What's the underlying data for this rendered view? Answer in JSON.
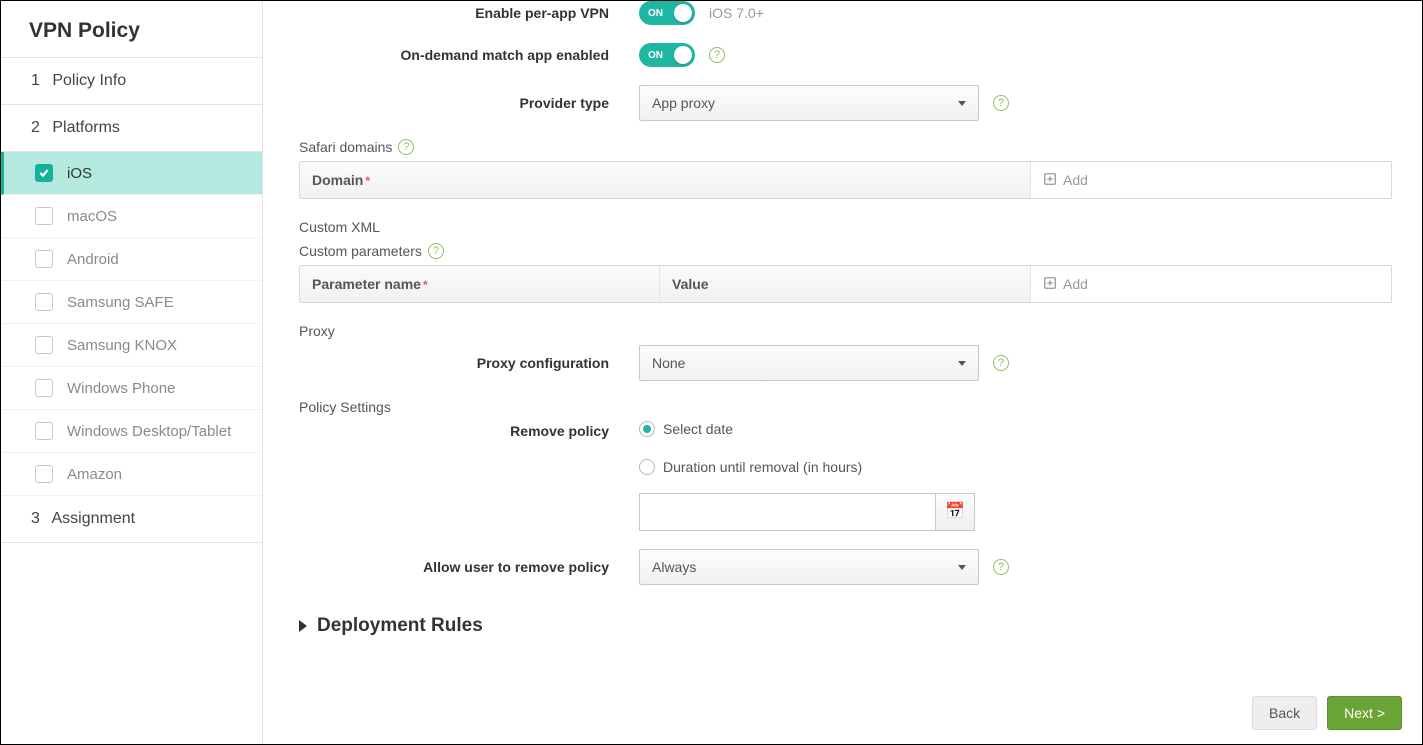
{
  "header": {
    "title": "VPN Policy"
  },
  "steps": {
    "s1": {
      "num": "1",
      "label": "Policy Info"
    },
    "s2": {
      "num": "2",
      "label": "Platforms"
    },
    "s3": {
      "num": "3",
      "label": "Assignment"
    }
  },
  "platforms": {
    "ios": "iOS",
    "macos": "macOS",
    "android": "Android",
    "safe": "Samsung SAFE",
    "knox": "Samsung KNOX",
    "winphone": "Windows Phone",
    "windesktop": "Windows Desktop/Tablet",
    "amazon": "Amazon"
  },
  "form": {
    "enable_per_app_vpn": {
      "label": "Enable per-app VPN",
      "toggle": "ON",
      "hint": "iOS 7.0+"
    },
    "on_demand_match": {
      "label": "On-demand match app enabled",
      "toggle": "ON"
    },
    "provider_type": {
      "label": "Provider type",
      "value": "App proxy"
    },
    "safari_domains": {
      "label": "Safari domains",
      "col1": "Domain",
      "add": "Add"
    },
    "custom_xml": {
      "label": "Custom XML",
      "params_label": "Custom parameters",
      "col1": "Parameter name",
      "col2": "Value",
      "add": "Add"
    },
    "proxy": {
      "section": "Proxy",
      "config_label": "Proxy configuration",
      "config_value": "None"
    },
    "policy_settings": {
      "section": "Policy Settings"
    },
    "remove_policy": {
      "label": "Remove policy",
      "opt1": "Select date",
      "opt2": "Duration until removal (in hours)"
    },
    "allow_remove": {
      "label": "Allow user to remove policy",
      "value": "Always"
    },
    "deployment_rules": "Deployment Rules"
  },
  "buttons": {
    "back": "Back",
    "next": "Next >"
  }
}
